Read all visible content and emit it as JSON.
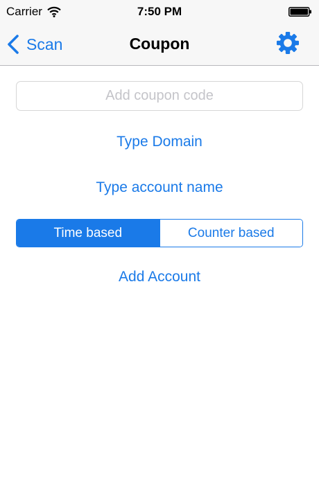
{
  "status_bar": {
    "carrier": "Carrier",
    "time": "7:50 PM",
    "wifi_icon": "wifi-icon",
    "battery_icon": "battery-icon"
  },
  "nav": {
    "back_label": "Scan",
    "title": "Coupon",
    "settings_icon": "gear-icon"
  },
  "form": {
    "coupon_placeholder": "Add coupon code",
    "coupon_value": "",
    "type_domain_label": "Type Domain",
    "type_account_label": "Type account name",
    "segments": [
      {
        "label": "Time based",
        "selected": true
      },
      {
        "label": "Counter based",
        "selected": false
      }
    ],
    "add_account_label": "Add Account"
  },
  "colors": {
    "accent": "#1a7ae8",
    "placeholder": "#c4c4c9",
    "bar_background": "#f7f7f7"
  }
}
